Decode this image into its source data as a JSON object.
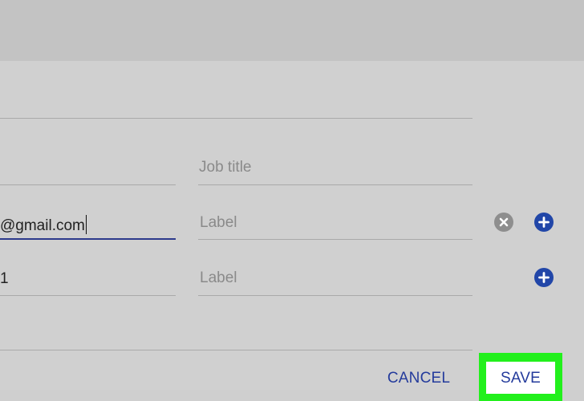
{
  "contact_form": {
    "job_title": {
      "placeholder": "Job title"
    },
    "email_row": {
      "value": "@gmail.com",
      "label_placeholder": "Label"
    },
    "phone_row": {
      "value": "1",
      "label_placeholder": "Label"
    }
  },
  "icons": {
    "remove": "remove-circle-icon",
    "add": "add-circle-icon"
  },
  "actions": {
    "cancel_label": "CANCEL",
    "save_label": "SAVE"
  },
  "colors": {
    "accent": "#2146a8",
    "button_text": "#243b9c",
    "highlight": "#22f01c",
    "background": "#d0d0d0"
  }
}
